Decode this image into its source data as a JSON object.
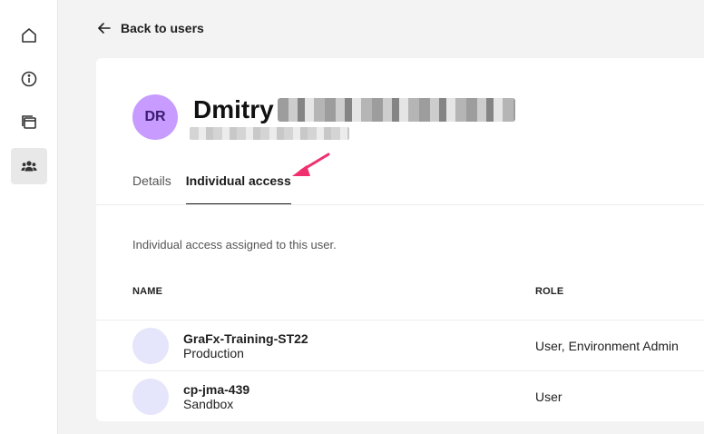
{
  "sidebar": {
    "items": [
      {
        "icon": "home-icon",
        "active": false
      },
      {
        "icon": "info-icon",
        "active": false
      },
      {
        "icon": "windows-icon",
        "active": false
      },
      {
        "icon": "users-icon",
        "active": true
      }
    ]
  },
  "back": {
    "label": "Back to users"
  },
  "user": {
    "initials": "DR",
    "first_name": "Dmitry"
  },
  "tabs": [
    {
      "label": "Details",
      "active": false
    },
    {
      "label": "Individual access",
      "active": true
    }
  ],
  "access": {
    "intro": "Individual access assigned to this user.",
    "columns": {
      "name": "NAME",
      "role": "ROLE"
    },
    "rows": [
      {
        "name": "GraFx-Training-ST22",
        "type": "Production",
        "role": "User, Environment Admin"
      },
      {
        "name": "cp-jma-439",
        "type": "Sandbox",
        "role": "User"
      }
    ]
  },
  "colors": {
    "avatar": "#c79bff",
    "annotation_arrow": "#f0306e",
    "row_avatar": "#e5e5fb"
  }
}
